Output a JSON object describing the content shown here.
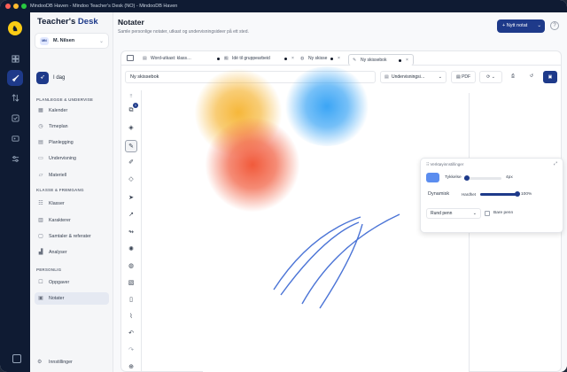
{
  "window": {
    "title": "MindooDB Haven - Mindoo Teacher's Desk (NO) - MindooDB Haven"
  },
  "app": {
    "brand_plain": "Teacher's ",
    "brand_bold": "Desk"
  },
  "user": {
    "initials": "MN",
    "name": "M. Nilsen"
  },
  "sidebar": {
    "today": "I dag",
    "sections": [
      {
        "title": "PLANLEGGE & UNDERVISE",
        "items": [
          "Kalender",
          "Timeplan",
          "Planlegging",
          "Undervisning",
          "Materiell"
        ]
      },
      {
        "title": "KLASSE & FREMGANG",
        "items": [
          "Klasser",
          "Karakterer",
          "Samtaler & referater",
          "Analyser"
        ]
      },
      {
        "title": "PERSONLIG",
        "items": [
          "Oppgaver",
          "Notater"
        ]
      }
    ],
    "settings": "Innstillinger"
  },
  "header": {
    "title": "Notater",
    "subtitle": "Samle personlige notater, utkast og undervisningsideer på ett sted.",
    "new_button": "+ Nytt notat",
    "help": "?"
  },
  "tabs": [
    {
      "label": "Word-utkast: klass…",
      "dirty": true
    },
    {
      "label": "Idé til gruppearbeid",
      "dirty": true
    },
    {
      "label": "Ny skisse",
      "dirty": true
    },
    {
      "label": "Ny skissebok",
      "dirty": true,
      "active": true
    }
  ],
  "toolbar": {
    "name_value": "Ny skissebok",
    "type_select": "Undervisningsi…",
    "pdf": "PDF"
  },
  "tools": {
    "layers_badge": "1"
  },
  "brush_panel": {
    "title": "Verktøyinnstillinger",
    "thickness_label": "Tykkelse",
    "thickness_value": "4px",
    "thickness_fraction": 0.08,
    "dynamic_label": "Dynamisk",
    "hardness_label": "Hardhet",
    "hardness_value": "100%",
    "hardness_fraction": 1.0,
    "pen_select": "Rund penn",
    "only_pen_label": "Bare penn",
    "color": "#5b8def"
  },
  "colors": {
    "accent": "#1e3a8a",
    "sidebar": "#0f1b33"
  }
}
